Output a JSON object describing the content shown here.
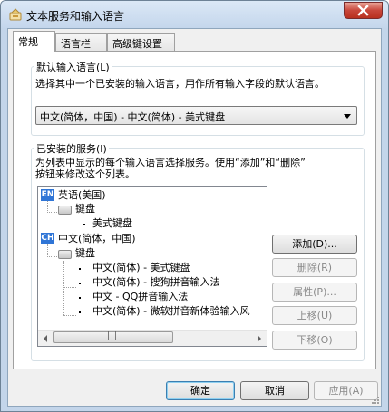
{
  "window": {
    "title": "文本服务和输入语言"
  },
  "tabs": [
    {
      "label": "常规"
    },
    {
      "label": "语言栏"
    },
    {
      "label": "高级键设置"
    }
  ],
  "default_language": {
    "group_label": "默认输入语言(L)",
    "description": "选择其中一个已安装的输入语言，用作所有输入字段的默认语言。",
    "selected_value": "中文(简体，中国) - 中文(简体) - 美式键盘"
  },
  "installed_services": {
    "group_label": "已安装的服务(I)",
    "description_line1": "为列表中显示的每个输入语言选择服务。使用“添加”和“删除”",
    "description_line2": "按钮来修改这个列表。",
    "tree": {
      "lang1": {
        "badge": "EN",
        "label": "英语(美国)"
      },
      "lang1_keyboard": "键盘",
      "lang1_items": [
        "美式键盘"
      ],
      "lang2": {
        "badge": "CH",
        "label": "中文(简体，中国)"
      },
      "lang2_keyboard": "键盘",
      "lang2_items": [
        "中文(简体) - 美式键盘",
        "中文(简体) - 搜狗拼音输入法",
        "中文 - QQ拼音输入法",
        "中文(简体) - 微软拼音新体验输入风"
      ]
    },
    "scroll_grip": "|||"
  },
  "side_buttons": {
    "add": "添加(D)...",
    "remove": "删除(R)",
    "properties": "属性(P)...",
    "move_up": "上移(U)",
    "move_down": "下移(O)"
  },
  "footer_buttons": {
    "ok": "确定",
    "cancel": "取消",
    "apply": "应用(A)"
  }
}
